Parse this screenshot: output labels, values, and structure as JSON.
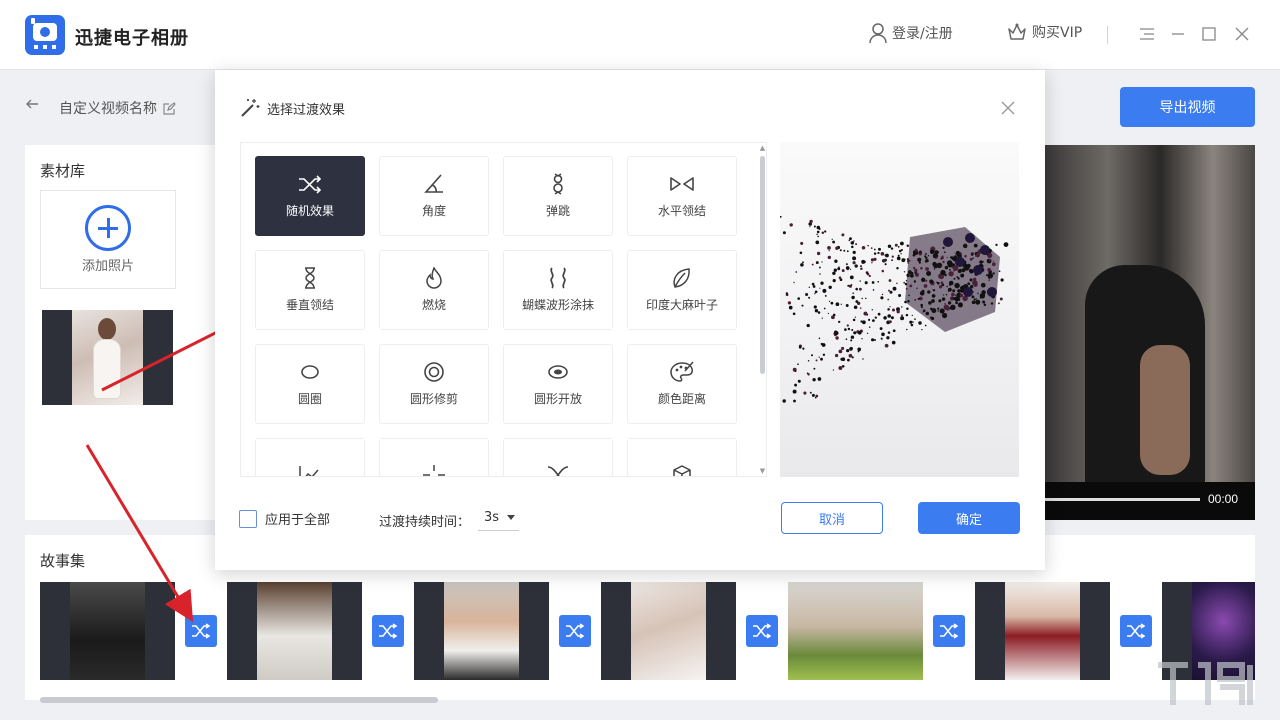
{
  "app": {
    "title": "迅捷电子相册",
    "login_label": "登录/注册",
    "vip_label": "购买VIP",
    "accent": "#3b7cf0"
  },
  "subheader": {
    "video_name": "自定义视频名称",
    "export_label": "导出视频"
  },
  "library": {
    "title": "素材库",
    "add_label": "添加照片"
  },
  "preview": {
    "time": "00:00"
  },
  "story": {
    "title": "故事集",
    "clip_count": 7
  },
  "dialog": {
    "title": "选择过渡效果",
    "effects": [
      {
        "label": "随机效果",
        "icon": "shuffle-icon",
        "selected": true
      },
      {
        "label": "角度",
        "icon": "angle-icon"
      },
      {
        "label": "弹跳",
        "icon": "bounce-icon"
      },
      {
        "label": "水平领结",
        "icon": "bowtie-horizontal-icon"
      },
      {
        "label": "垂直领结",
        "icon": "hourglass-icon"
      },
      {
        "label": "燃烧",
        "icon": "flame-icon"
      },
      {
        "label": "蝴蝶波形涂抹",
        "icon": "wave-icon"
      },
      {
        "label": "印度大麻叶子",
        "icon": "leaf-icon"
      },
      {
        "label": "圆圈",
        "icon": "ellipse-icon"
      },
      {
        "label": "圆形修剪",
        "icon": "circle-crop-icon"
      },
      {
        "label": "圆形开放",
        "icon": "circle-open-icon"
      },
      {
        "label": "颜色距离",
        "icon": "palette-icon"
      },
      {
        "label": "",
        "icon": "line-chart-icon"
      },
      {
        "label": "",
        "icon": "crosshair-icon"
      },
      {
        "label": "",
        "icon": "cross-curve-icon"
      },
      {
        "label": "",
        "icon": "cube-icon"
      }
    ],
    "apply_all_label": "应用于全部",
    "duration_label": "过渡持续时间：",
    "duration_value": "3s",
    "cancel_label": "取消",
    "ok_label": "确定"
  }
}
